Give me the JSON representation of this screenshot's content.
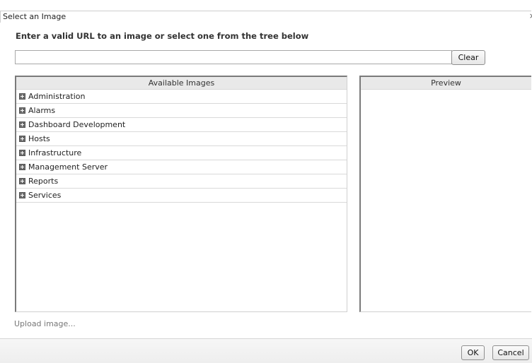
{
  "dialog": {
    "title": "Select an Image",
    "close_glyph": "×",
    "heading": "Enter a valid URL to an image or select one from the tree below"
  },
  "url_input": {
    "value": "",
    "placeholder": ""
  },
  "buttons": {
    "clear": "Clear",
    "ok": "OK",
    "cancel": "Cancel"
  },
  "available_images": {
    "header": "Available Images",
    "items": [
      {
        "label": "Administration",
        "icon": "expand-plus-icon"
      },
      {
        "label": "Alarms",
        "icon": "expand-plus-icon"
      },
      {
        "label": "Dashboard Development",
        "icon": "expand-plus-icon"
      },
      {
        "label": "Hosts",
        "icon": "expand-plus-icon"
      },
      {
        "label": "Infrastructure",
        "icon": "expand-plus-icon"
      },
      {
        "label": "Management Server",
        "icon": "expand-plus-icon"
      },
      {
        "label": "Reports",
        "icon": "expand-plus-icon"
      },
      {
        "label": "Services",
        "icon": "expand-plus-icon"
      }
    ]
  },
  "preview": {
    "header": "Preview"
  },
  "upload": {
    "label": "Upload image..."
  }
}
